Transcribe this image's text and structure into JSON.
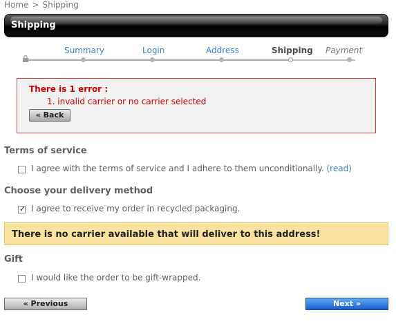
{
  "breadcrumb": {
    "home": "Home",
    "separator": ">",
    "current": "Shipping"
  },
  "header": {
    "title": "Shipping"
  },
  "steps": [
    {
      "label": "Summary",
      "state": "done"
    },
    {
      "label": "Login",
      "state": "done"
    },
    {
      "label": "Address",
      "state": "done"
    },
    {
      "label": "Shipping",
      "state": "current"
    },
    {
      "label": "Payment",
      "state": "future"
    }
  ],
  "error": {
    "title": "There is 1 error :",
    "items": [
      "1. invalid carrier or no carrier selected"
    ],
    "back_label": "« Back"
  },
  "terms": {
    "title": "Terms of service",
    "checkbox_label": "I agree with the terms of service and I adhere to them unconditionally.",
    "read_link": "(read)",
    "checked": false
  },
  "delivery": {
    "title": "Choose your delivery method",
    "recycled_label": "I agree to receive my order in recycled packaging.",
    "recycled_checked": true
  },
  "warning": {
    "text": "There is no carrier available that will deliver to this address!"
  },
  "gift": {
    "title": "Gift",
    "checkbox_label": "I would like the order to be gift-wrapped.",
    "checked": false
  },
  "nav": {
    "previous_label": "« Previous",
    "next_label": "Next »"
  },
  "colors": {
    "error_red": "#cc0000",
    "link_blue": "#3b82c4",
    "warning_bg": "#fae3a0",
    "next_blue": "#1d5fd0"
  }
}
